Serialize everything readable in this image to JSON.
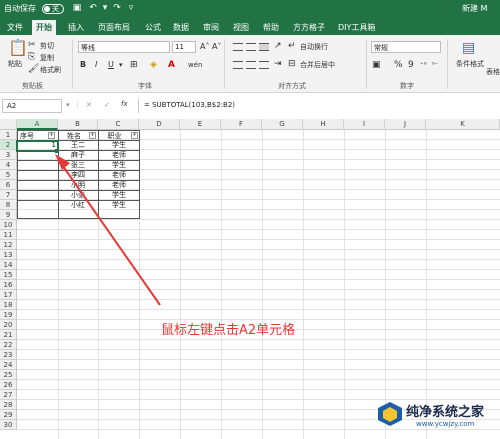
{
  "titlebar": {
    "autosave_label": "自动保存",
    "toggle_state": "关",
    "right_text": "新建 M"
  },
  "menu": {
    "tabs": [
      "文件",
      "开始",
      "插入",
      "页面布局",
      "公式",
      "数据",
      "审阅",
      "视图",
      "帮助",
      "方方格子",
      "DIY工具箱"
    ],
    "active": "开始"
  },
  "ribbon": {
    "clipboard": {
      "paste": "粘贴",
      "cut": "剪切",
      "copy": "复制",
      "format_painter": "格式刷",
      "group_label": "剪贴板"
    },
    "font": {
      "font_name": "等线",
      "font_size": "11",
      "bold": "B",
      "italic": "I",
      "underline": "U",
      "wen": "wén",
      "group_label": "字体"
    },
    "alignment": {
      "wrap": "自动换行",
      "merge": "合并后居中",
      "group_label": "对齐方式"
    },
    "number": {
      "format": "常规",
      "percent": "%",
      "comma": "9",
      "group_label": "数字"
    },
    "styles": {
      "conditional": "条件格式",
      "table": "表格"
    }
  },
  "formula_bar": {
    "name_box": "A2",
    "cancel": "✕",
    "enter": "✓",
    "fx": "fx",
    "formula": "= SUBTOTAL(103,B$2:B2)"
  },
  "grid": {
    "columns": [
      "A",
      "B",
      "C",
      "D",
      "E",
      "F",
      "G",
      "H",
      "I",
      "J",
      "K"
    ],
    "rows": [
      "1",
      "2",
      "3",
      "4",
      "5",
      "6",
      "7",
      "8",
      "9",
      "10",
      "11",
      "12",
      "13",
      "14",
      "15",
      "16",
      "17",
      "18",
      "19",
      "20",
      "21",
      "22",
      "23",
      "24",
      "25",
      "26",
      "27",
      "28",
      "29",
      "30"
    ],
    "headers": [
      "序号",
      "姓名",
      "职业"
    ],
    "data": [
      {
        "a": "1",
        "b": "王二",
        "c": "学生"
      },
      {
        "a": "",
        "b": "麻子",
        "c": "老师"
      },
      {
        "a": "",
        "b": "张三",
        "c": "学生"
      },
      {
        "a": "",
        "b": "李四",
        "c": "老师"
      },
      {
        "a": "",
        "b": "小明",
        "c": "老师"
      },
      {
        "a": "",
        "b": "小张",
        "c": "学生"
      },
      {
        "a": "",
        "b": "小红",
        "c": "学生"
      }
    ],
    "selected_cell": "A2"
  },
  "annotation": "鼠标左键点击A2单元格",
  "watermark": {
    "title": "纯净系统之家",
    "url": "www.ycwjzy.com"
  },
  "colors": {
    "excel_green": "#217346",
    "annotation_red": "#e53935"
  }
}
